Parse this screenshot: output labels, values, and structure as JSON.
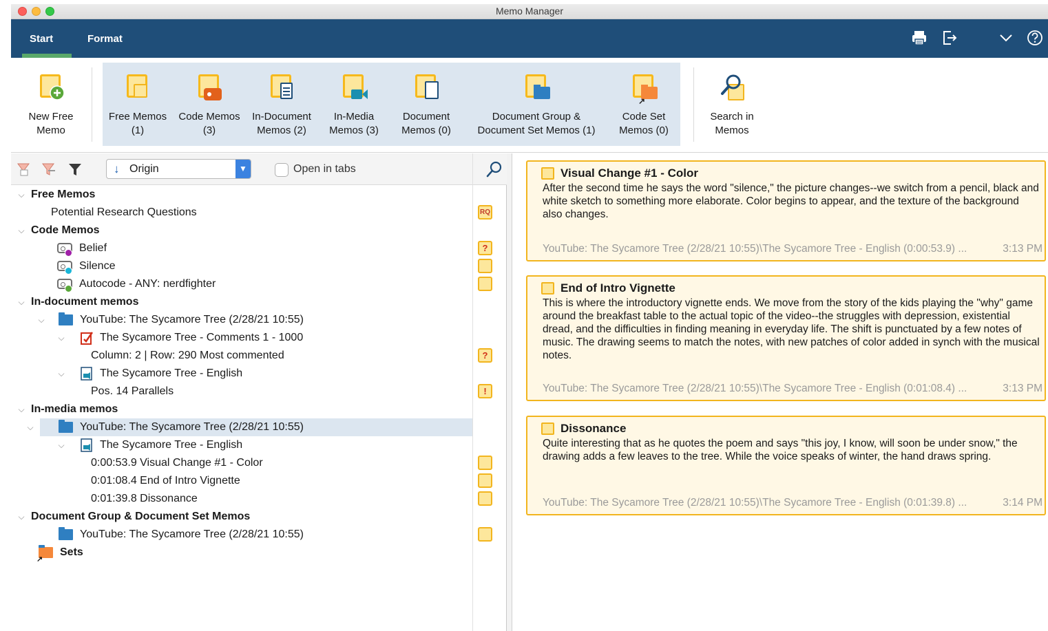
{
  "window": {
    "title": "Memo Manager"
  },
  "tabs": [
    {
      "label": "Start",
      "active": true
    },
    {
      "label": "Format",
      "active": false
    }
  ],
  "toolbar_icons": [
    "print-icon",
    "export-icon",
    "collapse-icon",
    "help-icon"
  ],
  "ribbon": {
    "new_free_memo": {
      "line1": "New Free",
      "line2": "Memo"
    },
    "free_memos": {
      "line1": "Free Memos",
      "line2": "(1)"
    },
    "code_memos": {
      "line1": "Code Memos",
      "line2": "(3)"
    },
    "in_document_memos": {
      "line1": "In-Document",
      "line2": "Memos (2)"
    },
    "in_media_memos": {
      "line1": "In-Media",
      "line2": "Memos (3)"
    },
    "document_memos": {
      "line1": "Document",
      "line2": "Memos (0)"
    },
    "doc_group_memos": {
      "line1": "Document Group &",
      "line2": "Document Set Memos (1)"
    },
    "code_set_memos": {
      "line1": "Code Set",
      "line2": "Memos (0)"
    },
    "search_in_memos": {
      "line1": "Search in",
      "line2": "Memos"
    }
  },
  "filterbar": {
    "sort_label": "Origin",
    "open_in_tabs_label": "Open in tabs",
    "open_in_tabs_checked": false
  },
  "tree": {
    "free_memos": "Free Memos",
    "potential_rq": "Potential Research Questions",
    "potential_rq_badge": "RQ",
    "code_memos": "Code Memos",
    "belief": "Belief",
    "silence": "Silence",
    "autocode": "Autocode - ANY: nerdfighter",
    "in_document_memos": "In-document memos",
    "yt_doc": "YouTube: The Sycamore Tree (2/28/21 10:55)",
    "comments_doc": "The Sycamore Tree -  Comments 1 - 1000",
    "column_row": "Column: 2 | Row: 290   Most commented",
    "english_doc": "The Sycamore Tree - English",
    "pos14": "Pos. 14   Parallels",
    "in_media_memos": "In-media memos",
    "yt_media": "YouTube: The Sycamore Tree (2/28/21 10:55)",
    "english_media": "The Sycamore Tree - English",
    "m1": "0:00:53.9   Visual Change #1 - Color",
    "m2": "0:01:08.4   End of Intro Vignette",
    "m3": "0:01:39.8   Dissonance",
    "doc_group_memos": "Document Group & Document Set Memos",
    "yt_group": "YouTube: The Sycamore Tree (2/28/21 10:55)",
    "sets": "Sets",
    "q_mark": "?",
    "ex_mark": "!"
  },
  "memo_cards": [
    {
      "title": "Visual Change #1 - Color",
      "body": "After the second time he says the word \"silence,\" the picture changes--we switch from a pencil, black and white sketch to something more elaborate. Color begins to appear, and the texture of the background also changes.",
      "source": "YouTube: The Sycamore Tree (2/28/21 10:55)\\The Sycamore Tree - English (0:00:53.9) ...",
      "time": "3:13 PM"
    },
    {
      "title": "End of Intro Vignette",
      "body": "This is where the introductory vignette ends. We move from the story of the kids playing the \"why\" game around the breakfast table to the actual topic of the video--the struggles with depression, existential dread, and the difficulties in finding meaning in everyday life. The shift is punctuated by a few notes of music. The drawing seems to match the notes, with new patches of color added in synch with the musical notes.",
      "source": "YouTube: The Sycamore Tree (2/28/21 10:55)\\The Sycamore Tree - English (0:01:08.4) ...",
      "time": "3:13 PM"
    },
    {
      "title": "Dissonance",
      "body": "Quite interesting that as he quotes the poem and says \"this joy, I know, will soon be under snow,\" the drawing adds a few leaves to the tree. While the voice speaks of winter, the hand draws spring.",
      "source": "YouTube: The Sycamore Tree (2/28/21 10:55)\\The Sycamore Tree - English (0:01:39.8) ...",
      "time": "3:14 PM"
    }
  ],
  "colors": {
    "ribbon_blue": "#1f4e79",
    "memo_yellow": "#fde79c",
    "memo_border": "#f2b51e",
    "selection": "#dce6f0",
    "belief_dot": "#a020a8",
    "silence_dot": "#19b6d8",
    "autocode_dot": "#5aa83a"
  }
}
